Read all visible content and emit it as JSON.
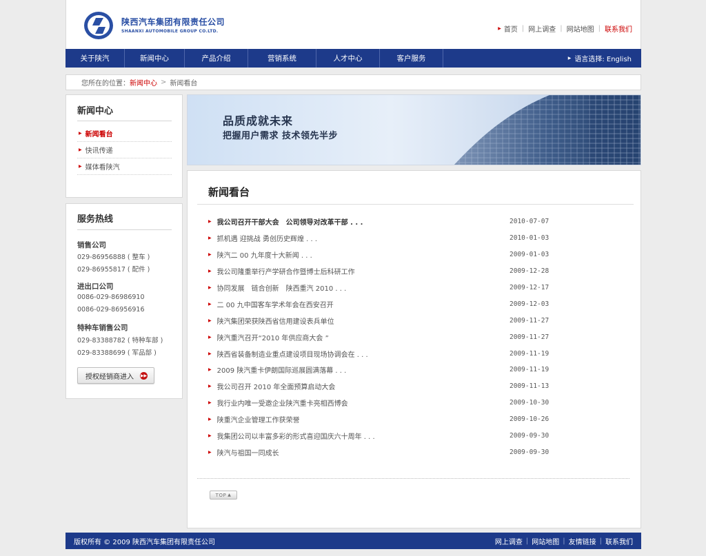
{
  "header": {
    "company_cn": "陕西汽车集团有限责任公司",
    "company_en": "SHAANXI AUTOMOBILE GROUP CO.LTD.",
    "links": [
      {
        "label": "首页"
      },
      {
        "label": "网上调查"
      },
      {
        "label": "网站地图"
      },
      {
        "label": "联系我们"
      }
    ]
  },
  "nav": {
    "items": [
      "关于陕汽",
      "新闻中心",
      "产品介绍",
      "营销系统",
      "人才中心",
      "客户服务"
    ],
    "language": "语言选择: English"
  },
  "breadcrumb": {
    "prefix": "您所在的位置：",
    "section": "新闻中心",
    "current": "新闻看台"
  },
  "sidebar": {
    "menu_title": "新闻中心",
    "menu_items": [
      "新闻看台",
      "快讯传递",
      "媒体看陕汽"
    ],
    "hotline_title": "服务热线",
    "hotline": {
      "sales_title": "销售公司",
      "sales_1": "029-86956888 ( 整车 )",
      "sales_2": "029-86955817 ( 配件 )",
      "export_title": "进出口公司",
      "export_1": "0086-029-86986910",
      "export_2": "0086-029-86956916",
      "special_title": "特种车销售公司",
      "special_1": "029-83388782 ( 特种车部 )",
      "special_2": "029-83388699 ( 军品部 )"
    },
    "dealer_button": "授权经销商进入"
  },
  "banner": {
    "line1": "品质成就未来",
    "line2": "把握用户需求 技术领先半步"
  },
  "content": {
    "title": "新闻看台",
    "top_button": "TOP",
    "news": [
      {
        "title": "我公司召开干部大会　公司领导对改革干部 . . .",
        "date": "2010-07-07"
      },
      {
        "title": "抓机遇 迎挑战 勇创历史辉煌 . . .",
        "date": "2010-01-03"
      },
      {
        "title": "陕汽二 00 九年度十大新闻 . . .",
        "date": "2009-01-03"
      },
      {
        "title": "我公司隆重举行产学研合作暨博士后科研工作",
        "date": "2009-12-28"
      },
      {
        "title": "协同发展　链合创新　陕西重汽 2010 . . .",
        "date": "2009-12-17"
      },
      {
        "title": "二 00 九中国客车学术年会在西安召开",
        "date": "2009-12-03"
      },
      {
        "title": "陕汽集团荣获陕西省信用建设表兵单位",
        "date": "2009-11-27"
      },
      {
        "title": "陕汽重汽召开“2010 年供应商大会 ”",
        "date": "2009-11-27"
      },
      {
        "title": "陕西省装备制造业重点建设项目现场协调会在 . . .",
        "date": "2009-11-19"
      },
      {
        "title": "2009 陕汽重卡伊朗国际巡展圆满落幕 . . .",
        "date": "2009-11-19"
      },
      {
        "title": "我公司召开 2010 年全面预算启动大会",
        "date": "2009-11-13"
      },
      {
        "title": "我行业内唯一受邀企业陕汽重卡亮相西博会",
        "date": "2009-10-30"
      },
      {
        "title": "陕重汽企业管理工作获荣誉",
        "date": "2009-10-26"
      },
      {
        "title": "我集团公司以丰富多彩的形式喜迎国庆六十周年 . . .",
        "date": "2009-09-30"
      },
      {
        "title": "陕汽与祖国一同成长",
        "date": "2009-09-30"
      }
    ]
  },
  "footer": {
    "copyright": "版权所有 © 2009 陕西汽车集团有限责任公司",
    "links": [
      "网上调查",
      "网站地图",
      "友情链接",
      "联系我们"
    ]
  },
  "colors": {
    "nav_blue": "#1d3a8a",
    "accent_red": "#cc0000",
    "logo_blue": "#2a4fa4"
  }
}
